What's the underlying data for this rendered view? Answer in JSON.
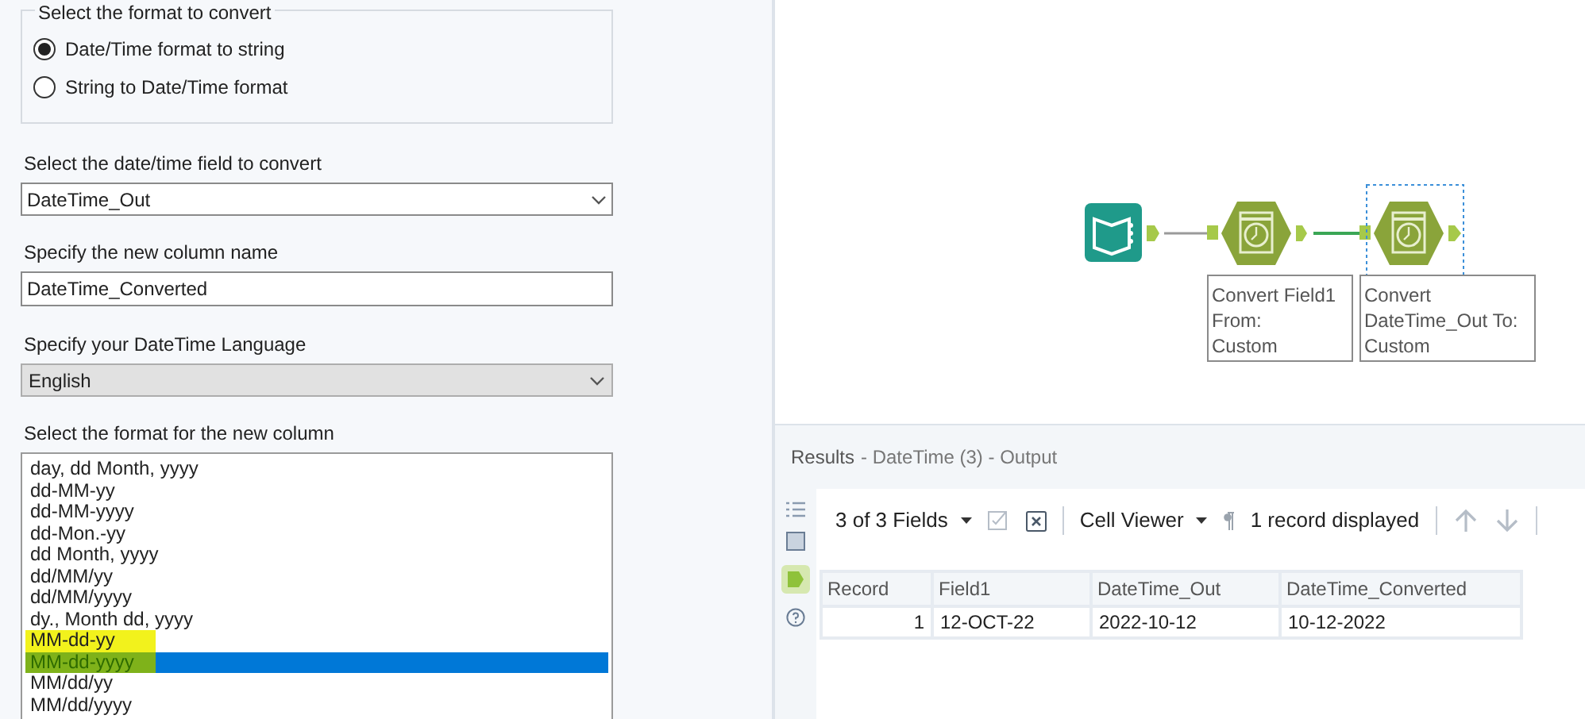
{
  "config": {
    "format_group": {
      "legend": "Select the format to convert",
      "options": [
        {
          "label": "Date/Time format to string",
          "selected": true
        },
        {
          "label": "String to Date/Time format",
          "selected": false
        }
      ]
    },
    "field_select": {
      "label": "Select the date/time field to convert",
      "value": "DateTime_Out"
    },
    "column_name": {
      "label": "Specify the new column name",
      "value": "DateTime_Converted"
    },
    "language": {
      "label": "Specify your DateTime Language",
      "value": "English",
      "disabled": true
    },
    "format_list": {
      "label": "Select the format for the new column",
      "items": [
        {
          "label": "day, dd Month, yyyy",
          "selected": false,
          "highlighted": false
        },
        {
          "label": "dd-MM-yy",
          "selected": false,
          "highlighted": false
        },
        {
          "label": "dd-MM-yyyy",
          "selected": false,
          "highlighted": false
        },
        {
          "label": "dd-Mon.-yy",
          "selected": false,
          "highlighted": false
        },
        {
          "label": "dd Month, yyyy",
          "selected": false,
          "highlighted": false
        },
        {
          "label": "dd/MM/yy",
          "selected": false,
          "highlighted": false
        },
        {
          "label": "dd/MM/yyyy",
          "selected": false,
          "highlighted": false
        },
        {
          "label": "dy., Month dd, yyyy",
          "selected": false,
          "highlighted": false
        },
        {
          "label": "MM-dd-yy",
          "selected": false,
          "highlighted": true
        },
        {
          "label": "MM-dd-yyyy",
          "selected": true,
          "highlighted": true
        },
        {
          "label": "MM/dd/yy",
          "selected": false,
          "highlighted": false
        },
        {
          "label": "MM/dd/yyyy",
          "selected": false,
          "highlighted": false
        }
      ]
    }
  },
  "canvas": {
    "tools": [
      {
        "kind": "input",
        "selected": false
      },
      {
        "kind": "datetime",
        "selected": false,
        "annotation": [
          "Convert Field1",
          "From:",
          "Custom"
        ]
      },
      {
        "kind": "datetime",
        "selected": true,
        "annotation": [
          "Convert",
          "DateTime_Out To:",
          "Custom"
        ]
      }
    ]
  },
  "results": {
    "title": "Results",
    "subtitle": "- DateTime (3) - Output",
    "toolbar": {
      "fields": "3 of 3 Fields",
      "viewer": "Cell Viewer",
      "records": "1 record displayed"
    },
    "columns": [
      "Record",
      "Field1",
      "DateTime_Out",
      "DateTime_Converted"
    ],
    "rows": [
      [
        "1",
        "12-OCT-22",
        "2022-10-12",
        "10-12-2022"
      ]
    ]
  }
}
